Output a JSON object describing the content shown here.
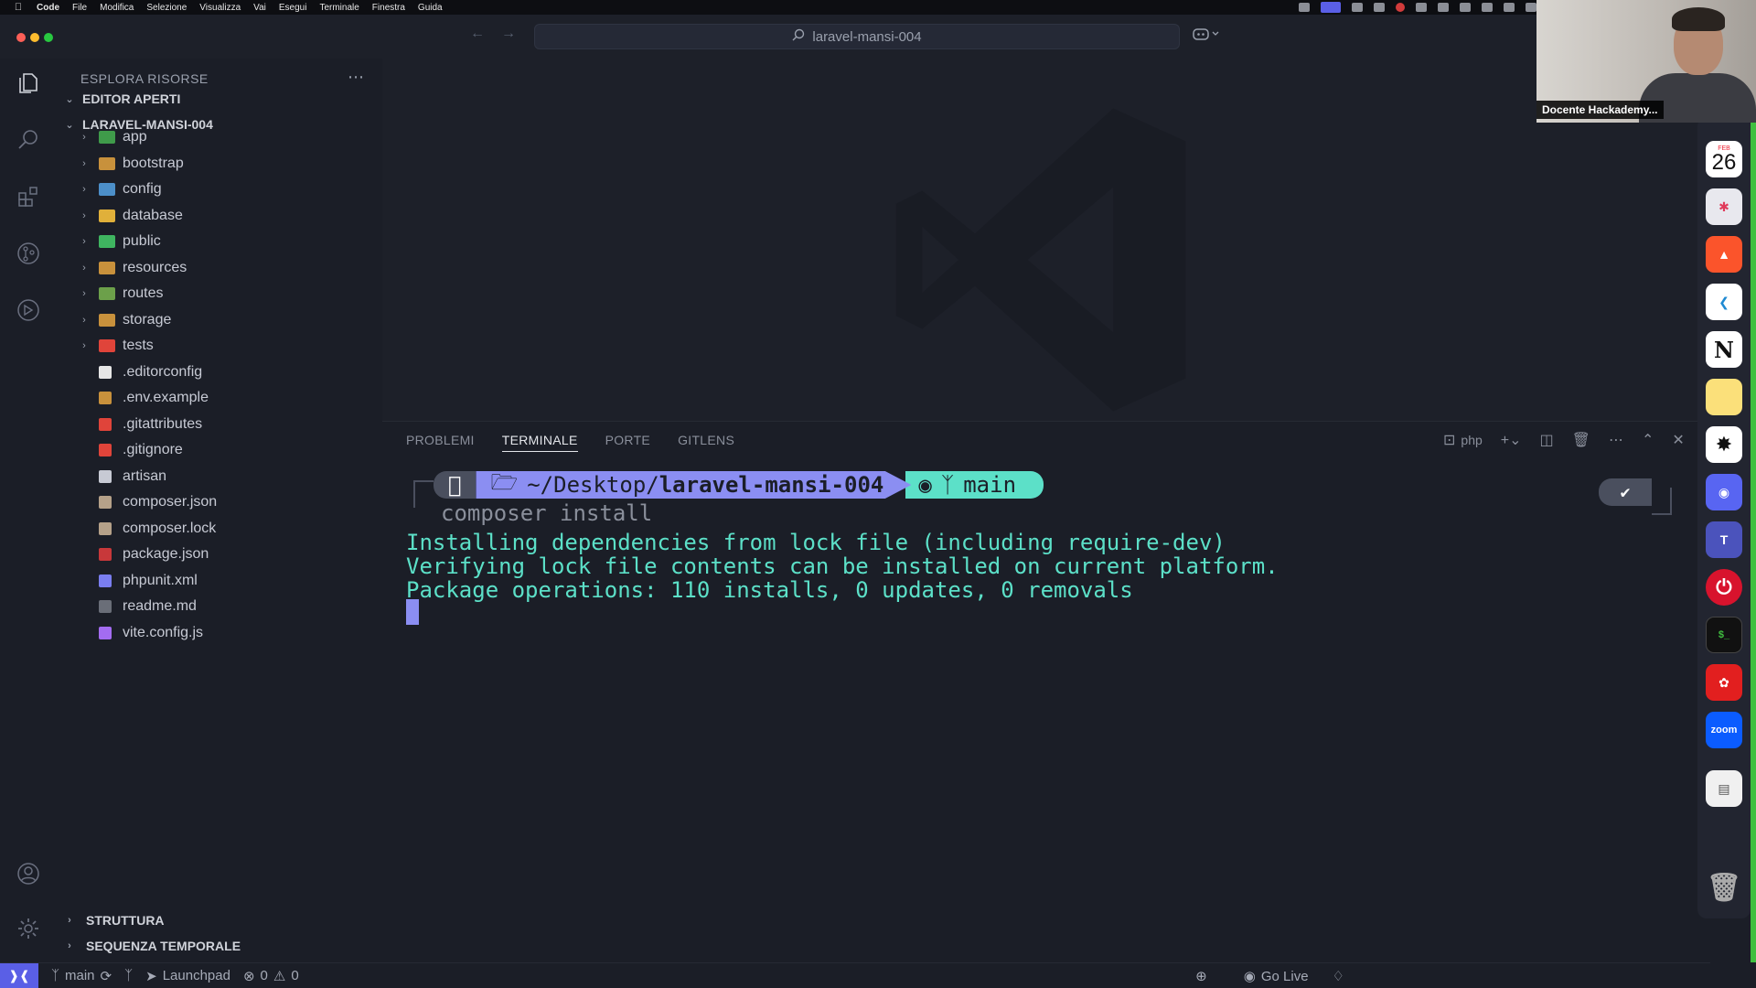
{
  "menubar": {
    "items": [
      "Code",
      "File",
      "Modifica",
      "Selezione",
      "Visualizza",
      "Vai",
      "Esegui",
      "Terminale",
      "Finestra",
      "Guida"
    ]
  },
  "titlebar": {
    "search_text": "laravel-mansi-004"
  },
  "sidebar": {
    "title": "ESPLORA RISORSE",
    "open_editors": "EDITOR APERTI",
    "project": "LARAVEL-MANSI-004",
    "folders": [
      {
        "name": "app",
        "icon": "app-folder-icon",
        "color": "#3f9b4a"
      },
      {
        "name": "bootstrap",
        "icon": "folder-icon",
        "color": "#c8913c"
      },
      {
        "name": "config",
        "icon": "config-folder-icon",
        "color": "#4c8fc9"
      },
      {
        "name": "database",
        "icon": "database-folder-icon",
        "color": "#e0b03a"
      },
      {
        "name": "public",
        "icon": "public-folder-icon",
        "color": "#3fb560"
      },
      {
        "name": "resources",
        "icon": "folder-icon",
        "color": "#c8913c"
      },
      {
        "name": "routes",
        "icon": "routes-folder-icon",
        "color": "#6ca04a"
      },
      {
        "name": "storage",
        "icon": "folder-icon",
        "color": "#c8913c"
      },
      {
        "name": "tests",
        "icon": "tests-folder-icon",
        "color": "#e0443a"
      }
    ],
    "files": [
      {
        "name": ".editorconfig",
        "icon": "editorconfig-icon",
        "color": "#e6e6e6"
      },
      {
        "name": ".env.example",
        "icon": "env-icon",
        "color": "#c8913c"
      },
      {
        "name": ".gitattributes",
        "icon": "git-icon",
        "color": "#e0443a"
      },
      {
        "name": ".gitignore",
        "icon": "git-icon",
        "color": "#e0443a"
      },
      {
        "name": "artisan",
        "icon": "file-icon",
        "color": "#c7cad4"
      },
      {
        "name": "composer.json",
        "icon": "composer-icon",
        "color": "#b5a189"
      },
      {
        "name": "composer.lock",
        "icon": "composer-icon",
        "color": "#b5a189"
      },
      {
        "name": "package.json",
        "icon": "npm-icon",
        "color": "#c8383a"
      },
      {
        "name": "phpunit.xml",
        "icon": "phpunit-icon",
        "color": "#7a7ef0"
      },
      {
        "name": "readme.md",
        "icon": "markdown-icon",
        "color": "#6a6e78"
      },
      {
        "name": "vite.config.js",
        "icon": "vite-icon",
        "color": "#a36cf0"
      }
    ],
    "outline": "STRUTTURA",
    "timeline": "SEQUENZA TEMPORALE"
  },
  "panel": {
    "tabs": [
      "PROBLEMI",
      "TERMINALE",
      "PORTE",
      "GITLENS"
    ],
    "active_tab": "TERMINALE",
    "shell_label": "php"
  },
  "terminal": {
    "path_prefix": "~/Desktop/",
    "path_dir": "laravel-mansi-004",
    "branch": "main",
    "command": "composer install",
    "output": [
      "Installing dependencies from lock file (including require-dev)",
      "Verifying lock file contents can be installed on current platform.",
      "Package operations: 110 installs, 0 updates, 0 removals"
    ],
    "status_check": "✔"
  },
  "statusbar": {
    "branch": "main",
    "launchpad": "Launchpad",
    "errors": "0",
    "warnings": "0",
    "go_live": "Go Live"
  },
  "dock": {
    "calendar_month": "FEB",
    "calendar_day": "26",
    "apps": [
      "calendar",
      "mindnode",
      "brave",
      "vscode",
      "notion",
      "notes",
      "chatgpt",
      "discord",
      "teams",
      "power",
      "terminal",
      "acrobat",
      "zoom",
      "preview",
      "trash"
    ],
    "zoom_label": "zoom"
  },
  "webcam": {
    "label": "Docente Hackademy..."
  },
  "colors": {
    "accent": "#5a5fe6",
    "terminal_output": "#5ce0c8",
    "path_segment": "#8b8ef2"
  }
}
